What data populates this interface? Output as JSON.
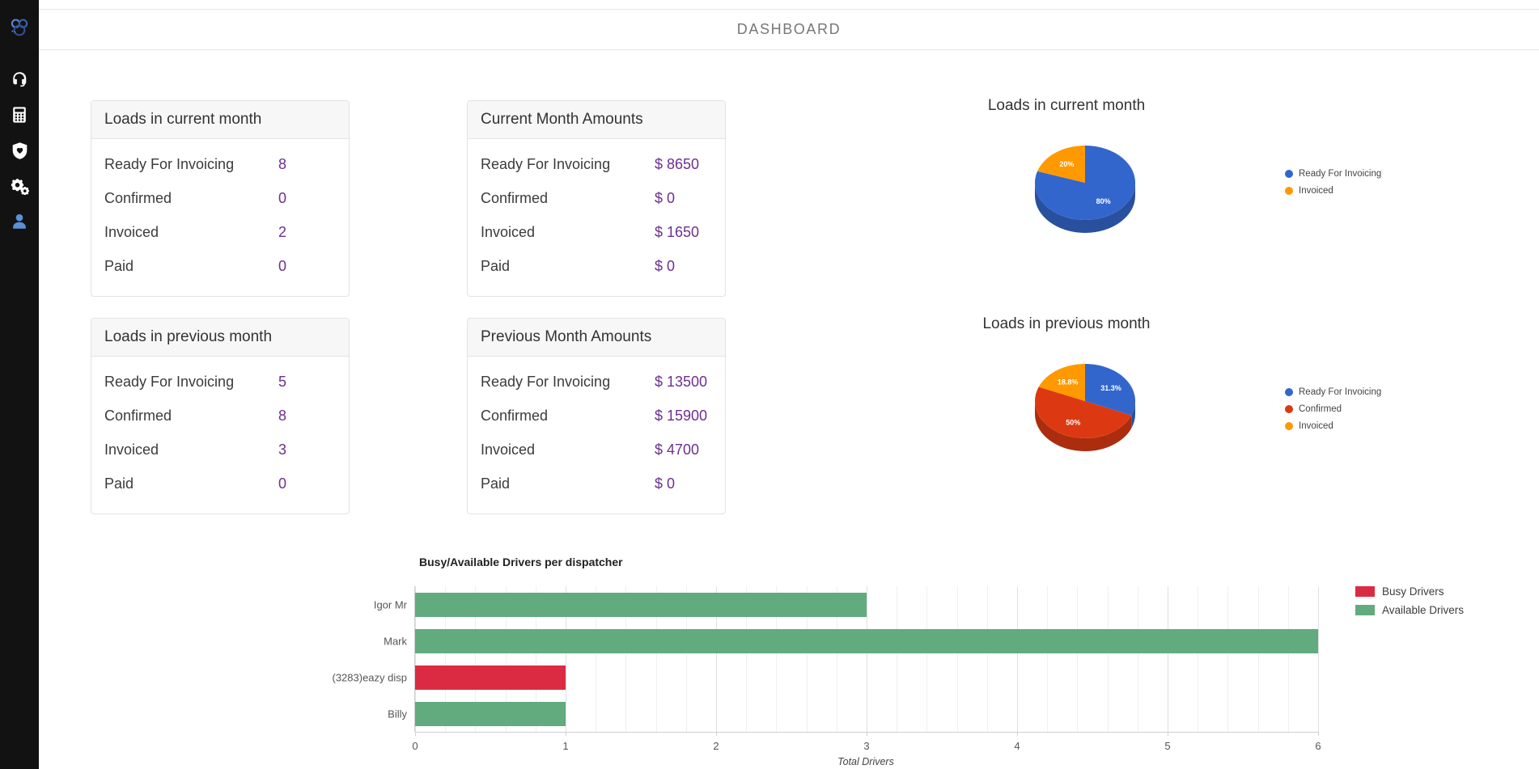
{
  "header": {
    "title": "DASHBOARD"
  },
  "sidebar": {
    "items": [
      {
        "icon": "app-logo-icon",
        "label": "Logo"
      },
      {
        "icon": "headset-icon",
        "label": "Support"
      },
      {
        "icon": "calculator-icon",
        "label": "Accounting"
      },
      {
        "icon": "shield-heart-icon",
        "label": "Safety"
      },
      {
        "icon": "gears-icon",
        "label": "Settings"
      },
      {
        "icon": "user-icon",
        "label": "Profile"
      }
    ]
  },
  "cards": {
    "loads_current": {
      "title": "Loads in current month",
      "rows": [
        {
          "label": "Ready For Invoicing",
          "value": "8"
        },
        {
          "label": "Confirmed",
          "value": "0"
        },
        {
          "label": "Invoiced",
          "value": "2"
        },
        {
          "label": "Paid",
          "value": "0"
        }
      ]
    },
    "amounts_current": {
      "title": "Current Month Amounts",
      "rows": [
        {
          "label": "Ready For Invoicing",
          "value": "$ 8650"
        },
        {
          "label": "Confirmed",
          "value": "$ 0"
        },
        {
          "label": "Invoiced",
          "value": "$ 1650"
        },
        {
          "label": "Paid",
          "value": "$ 0"
        }
      ]
    },
    "loads_previous": {
      "title": "Loads in previous month",
      "rows": [
        {
          "label": "Ready For Invoicing",
          "value": "5"
        },
        {
          "label": "Confirmed",
          "value": "8"
        },
        {
          "label": "Invoiced",
          "value": "3"
        },
        {
          "label": "Paid",
          "value": "0"
        }
      ]
    },
    "amounts_previous": {
      "title": "Previous Month Amounts",
      "rows": [
        {
          "label": "Ready For Invoicing",
          "value": "$ 13500"
        },
        {
          "label": "Confirmed",
          "value": "$ 15900"
        },
        {
          "label": "Invoiced",
          "value": "$ 4700"
        },
        {
          "label": "Paid",
          "value": "$ 0"
        }
      ]
    }
  },
  "colors": {
    "value_purple": "#6d2f8e",
    "pie_blue": "#3366cc",
    "pie_red": "#dc3912",
    "pie_orange": "#ff9900",
    "bar_busy_red": "#db2b42",
    "bar_available_green": "#62ab7f",
    "sidebar_bg": "#121212",
    "accent_blue": "#4a7fd4"
  },
  "chart_data": [
    {
      "type": "pie",
      "title": "Loads in current month",
      "labels": [
        "Ready For Invoicing",
        "Invoiced"
      ],
      "values": [
        80,
        20
      ],
      "data_labels": [
        "80%",
        "20%"
      ],
      "colors": [
        "#3366cc",
        "#ff9900"
      ],
      "legend_position": "right",
      "three_d": true
    },
    {
      "type": "pie",
      "title": "Loads in previous month",
      "labels": [
        "Ready For Invoicing",
        "Confirmed",
        "Invoiced"
      ],
      "values": [
        31.3,
        50,
        18.8
      ],
      "data_labels": [
        "31.3%",
        "50%",
        "18.8%"
      ],
      "colors": [
        "#3366cc",
        "#dc3912",
        "#ff9900"
      ],
      "legend_position": "right",
      "three_d": true
    },
    {
      "type": "bar",
      "orientation": "horizontal",
      "title": "Busy/Available Drivers per dispatcher",
      "categories": [
        "Igor Mr",
        "Mark",
        "(3283)eazy disp",
        "Billy"
      ],
      "series": [
        {
          "name": "Busy Drivers",
          "color": "#db2b42",
          "values": [
            0,
            0,
            1,
            0
          ]
        },
        {
          "name": "Available Drivers",
          "color": "#62ab7f",
          "values": [
            3,
            6,
            0,
            1
          ]
        }
      ],
      "xlabel": "Total Drivers",
      "ylabel": "",
      "xlim": [
        0,
        6
      ],
      "xticks": [
        "0",
        "1",
        "2",
        "3",
        "4",
        "5",
        "6"
      ],
      "grid": true,
      "legend_position": "right"
    }
  ]
}
